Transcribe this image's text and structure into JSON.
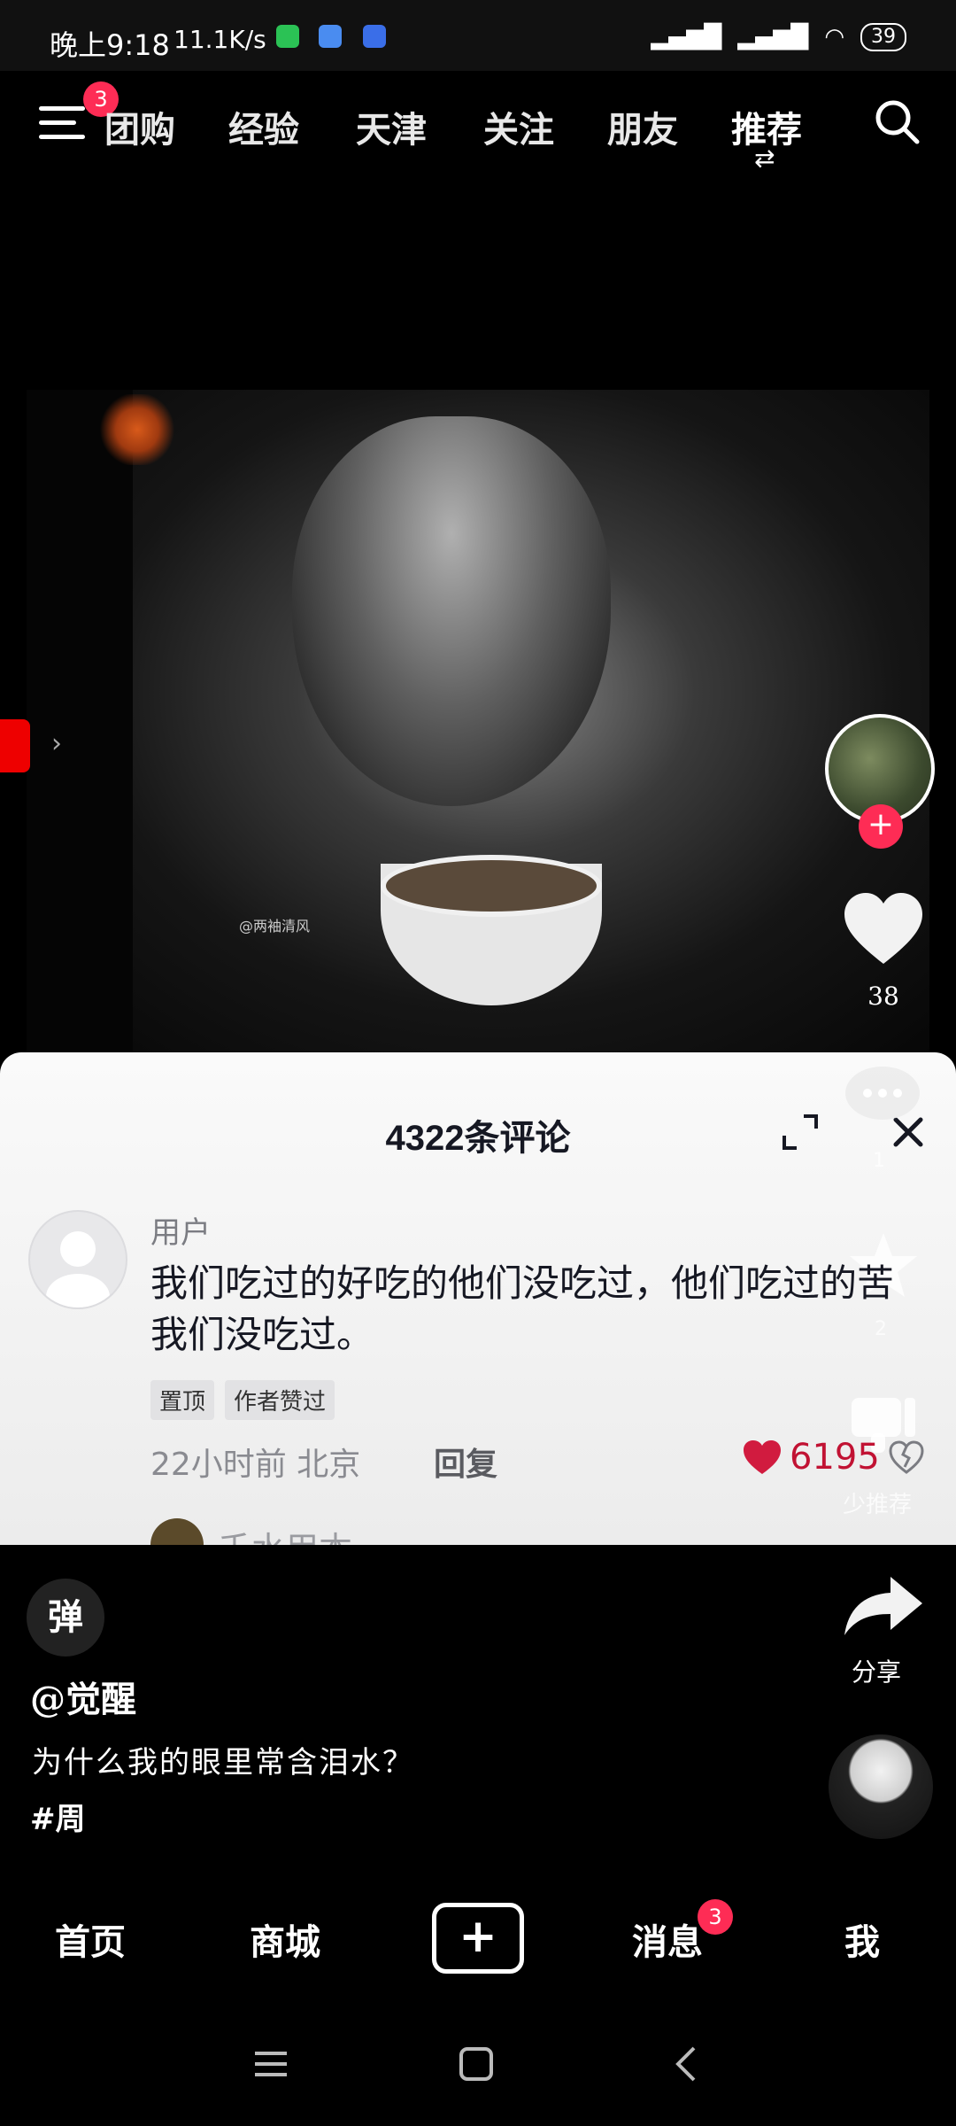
{
  "status_bar": {
    "time": "晚上9:18",
    "speed": "11.1K/s",
    "battery": "39"
  },
  "top_nav": {
    "menu_badge": "3",
    "tabs": [
      "团购",
      "经验",
      "天津",
      "关注",
      "朋友",
      "推荐"
    ],
    "active_tab": "推荐"
  },
  "video": {
    "watermark": "@两袖清风"
  },
  "side_actions": {
    "like_count": "38",
    "share_label": "分享",
    "not_recommend_label": "少推荐",
    "comment_count_fragment": "1",
    "favorite_count_fragment": "2"
  },
  "comment_sheet": {
    "title": "4322条评论",
    "comment": {
      "user": "用户",
      "text": "我们吃过的好吃的他们没吃过，他们吃过的苦我们没吃过。",
      "tags": [
        "置顶",
        "作者赞过"
      ],
      "meta": "22小时前 北京",
      "reply": "回复",
      "likes": "6195"
    },
    "next_comment_user": "千水用本"
  },
  "caption": {
    "danmu": "弹",
    "author": "@觉醒",
    "text": "为什么我的眼里常含泪水？",
    "hashtag": "#周"
  },
  "bottom_tabs": {
    "home": "首页",
    "mall": "商城",
    "plus": "+",
    "messages": "消息",
    "messages_badge": "3",
    "me": "我"
  },
  "colors": {
    "accent": "#fe2c55",
    "like_red": "#c11233",
    "sheet_bg": "#f5f5f5"
  }
}
